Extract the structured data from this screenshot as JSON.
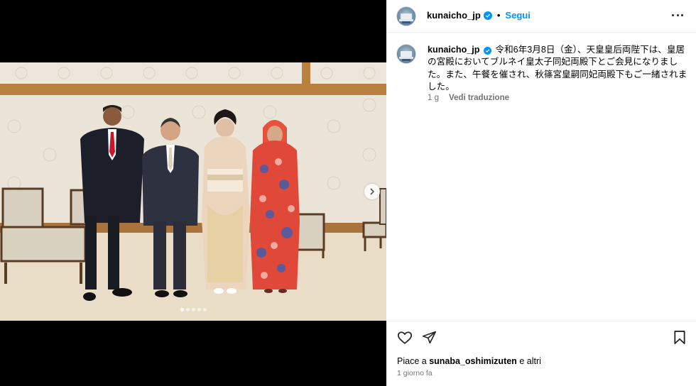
{
  "post": {
    "username": "kunaicho_jp",
    "follow_label": "Segui",
    "separator": "•",
    "caption": "令和6年3月8日（金）、天皇皇后両陛下は、皇居の宮殿においてブルネイ皇太子同妃両殿下とご会見になりました。また、午餐を催され、秋篠宮皇嗣同妃両殿下もご一緒されました。",
    "caption_age": "1 g",
    "translate_label": "Vedi traduzione",
    "likes_prefix": "Piace a",
    "likes_user": "sunaba_oshimizuten",
    "likes_suffix": "e altri",
    "posted_ago": "1 giorno fa"
  },
  "carousel": {
    "slide_count": 5,
    "active_index": 0
  },
  "icons": {
    "verified": "verified-badge-icon",
    "more": "more-options-icon",
    "like": "heart-icon",
    "share": "paper-plane-icon",
    "save": "bookmark-icon",
    "next": "chevron-right-icon"
  },
  "colors": {
    "accent": "#0095f6",
    "secondary_text": "#737373"
  }
}
